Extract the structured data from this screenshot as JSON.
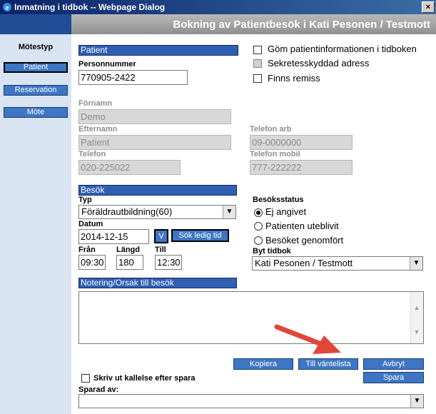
{
  "window": {
    "title": "Inmatning i tidbok -- Webpage Dialog",
    "close": "×"
  },
  "header": {
    "title": "Bokning av Patientbesök  i Kati Pesonen / Testmott"
  },
  "sidebar": {
    "label": "Mötestyp",
    "items": [
      {
        "label": "Patient",
        "active": true
      },
      {
        "label": "Reservation",
        "active": false
      },
      {
        "label": "Möte",
        "active": false
      }
    ]
  },
  "patient": {
    "section": "Patient",
    "personnummer_label": "Personnummer",
    "personnummer": "770905-2422",
    "fornamn_label": "Förnamn",
    "fornamn": "Demo",
    "efternamn_label": "Efternamn",
    "efternamn": "Patient",
    "telefon_label": "Telefon",
    "telefon": "020-225022",
    "telefon_arb_label": "Telefon arb",
    "telefon_arb": "09-0000000",
    "telefon_mobil_label": "Telefon mobil",
    "telefon_mobil": "777-222222"
  },
  "options": {
    "gom": "Göm patientinformationen i tidboken",
    "sekretess": "Sekretesskyddad adress",
    "remiss": "Finns remiss"
  },
  "besok": {
    "section": "Besök",
    "typ_label": "Typ",
    "typ": "Föräldrautbildning(60)",
    "datum_label": "Datum",
    "datum": "2014-12-15",
    "v_button": "V",
    "sok_button": "Sök ledig tid",
    "fran_label": "Från",
    "fran": "09:30",
    "langd_label": "Längd",
    "langd": "180",
    "till_label": "Till",
    "till": "12:30"
  },
  "status": {
    "label": "Besöksstatus",
    "options": [
      "Ej angivet",
      "Patienten uteblivit",
      "Besöket genomfört"
    ],
    "selected": 0
  },
  "tidbok": {
    "label": "Byt tidbok",
    "value": "Kati Pesonen / Testmott"
  },
  "notering": {
    "section": "Notering/Orsak till besök",
    "value": ""
  },
  "buttons": {
    "kopiera": "Kopiera",
    "vantelista": "Till väntelista",
    "avbryt": "Avbryt",
    "spara": "Spara"
  },
  "footer": {
    "skriv_ut": "Skriv ut kallelse efter spara",
    "sparad_av_label": "Sparad av:",
    "sparad_av": ""
  },
  "colors": {
    "accent": "#3f76c4",
    "section": "#2f5eb3",
    "sidebar": "#d9e4f2",
    "annotation_arrow": "#e2453a"
  }
}
